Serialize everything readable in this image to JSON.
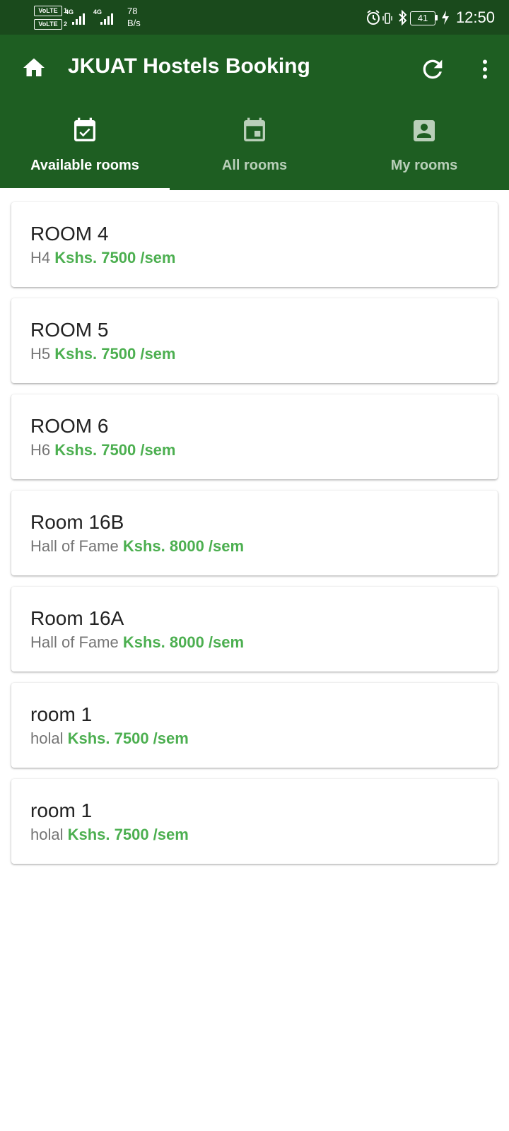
{
  "status_bar": {
    "volte_1": "VoLTE",
    "volte_2": "VoLTE",
    "sim_1": "1",
    "sim_2": "2",
    "network_1": "4G",
    "network_2": "4G",
    "speed_value": "78",
    "speed_unit": "B/s",
    "battery": "41",
    "time": "12:50"
  },
  "app_bar": {
    "title": "JKUAT Hostels Booking"
  },
  "tabs": [
    {
      "label": "Available rooms",
      "icon": "calendar-check-icon",
      "active": true
    },
    {
      "label": "All rooms",
      "icon": "calendar-today-icon",
      "active": false
    },
    {
      "label": "My rooms",
      "icon": "account-box-icon",
      "active": false
    }
  ],
  "colors": {
    "status_bar": "#1a4a1c",
    "app_bar": "#1e5e22",
    "price": "#4caf50"
  },
  "rooms": [
    {
      "name": "ROOM 4",
      "hostel": "H4",
      "price": "Kshs. 7500 /sem"
    },
    {
      "name": "ROOM 5",
      "hostel": "H5",
      "price": "Kshs. 7500 /sem"
    },
    {
      "name": "ROOM 6",
      "hostel": "H6",
      "price": "Kshs. 7500 /sem"
    },
    {
      "name": "Room 16B",
      "hostel": "Hall of Fame",
      "price": "Kshs. 8000 /sem"
    },
    {
      "name": "Room 16A",
      "hostel": "Hall of Fame",
      "price": "Kshs. 8000 /sem"
    },
    {
      "name": "room 1",
      "hostel": "holal",
      "price": "Kshs. 7500 /sem"
    },
    {
      "name": "room 1",
      "hostel": "holal",
      "price": "Kshs. 7500 /sem"
    }
  ]
}
